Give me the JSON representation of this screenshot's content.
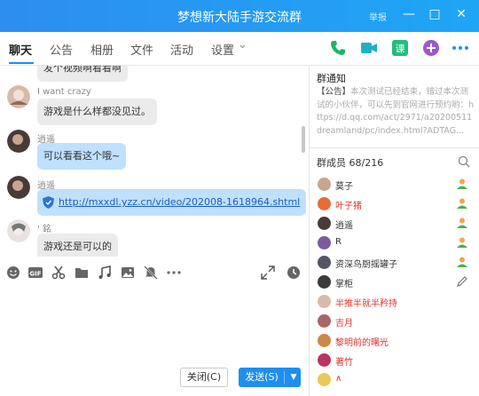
{
  "window": {
    "title": "梦想新大陆手游交流群",
    "report_label": "举报",
    "minimize": "—",
    "maximize": "□",
    "close": "✕"
  },
  "tabs": [
    {
      "label": "聊天",
      "active": true
    },
    {
      "label": "公告"
    },
    {
      "label": "相册"
    },
    {
      "label": "文件"
    },
    {
      "label": "活动"
    },
    {
      "label": "设置"
    }
  ],
  "settings_chevron": "⌄",
  "messages": [
    {
      "text": "发个视频啊看看啊"
    },
    {
      "nick": "I want crazy",
      "text": "游戏是什么样都没见过。"
    },
    {
      "nick": "逍遥",
      "text": "可以看看这个哦~"
    },
    {
      "nick": "逍遥",
      "link": "http://mxxdl.yzz.cn/video/202008-1618964.shtml"
    },
    {
      "nick": "' 銘",
      "text": "游戏还是可以的"
    }
  ],
  "composer": {
    "close_label": "关闭(C)",
    "send_label": "发送(S)",
    "send_dropdown": "▼"
  },
  "notice": {
    "heading": "群通知",
    "tag": "【公告】",
    "body": "本次测试已经结束，错过本次测试的小伙伴，可以先到官网进行预约哟：https://d.qq.com/act/2971/a20200511dreamland/pc/index.html?ADTAG..."
  },
  "members": {
    "heading": "群成员 68/216",
    "list": [
      {
        "name": "莫子",
        "color": "#333333",
        "role": "admin"
      },
      {
        "name": "叶子猪",
        "color": "#e0322c",
        "role": "admin"
      },
      {
        "name": "逍遥",
        "color": "#333333",
        "role": "admin"
      },
      {
        "name": "R",
        "color": "#333333",
        "role": "admin"
      },
      {
        "name": "资深鸟厨摇罐子",
        "color": "#333333",
        "role": "admin"
      },
      {
        "name": "掌柜",
        "color": "#333333",
        "role": "edit"
      },
      {
        "name": "半推半就半矜持",
        "color": "#e0322c",
        "role": ""
      },
      {
        "name": "吉月",
        "color": "#e0322c",
        "role": ""
      },
      {
        "name": "黎明前的曙光",
        "color": "#e0322c",
        "role": ""
      },
      {
        "name": "著竹",
        "color": "#e0322c",
        "role": ""
      },
      {
        "name": "∧",
        "color": "#e0322c",
        "role": ""
      }
    ]
  },
  "colors": {
    "accent": "#1e8ef0",
    "owner_red": "#e0322c"
  }
}
